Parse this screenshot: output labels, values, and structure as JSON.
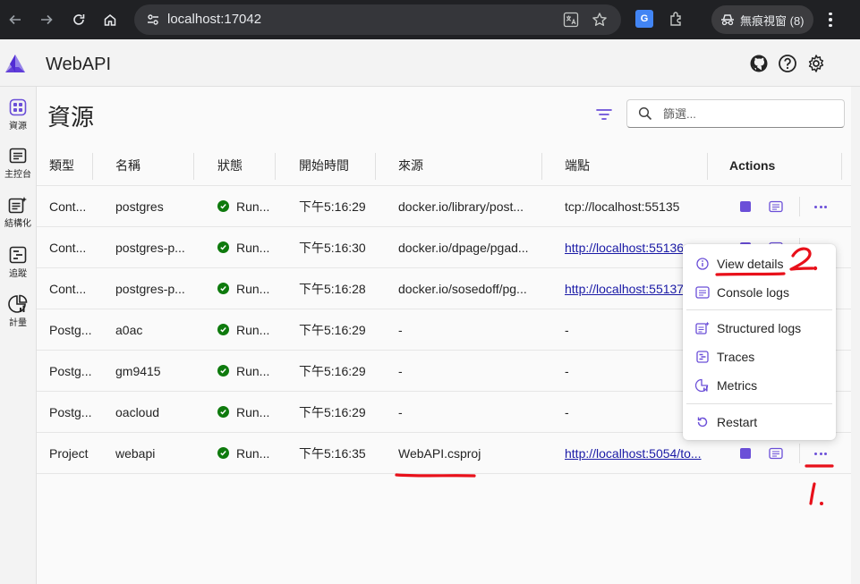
{
  "browser": {
    "url": "localhost:17042",
    "incognito_label": "無痕視窗 (8)",
    "icons": [
      "back-icon",
      "forward-icon",
      "reload-icon",
      "home-icon",
      "site-info-icon",
      "translate-icon",
      "star-icon",
      "extensions-icon",
      "incognito-icon",
      "kebab-menu-icon"
    ]
  },
  "app": {
    "title": "WebAPI",
    "header_icons": [
      "github-icon",
      "help-icon",
      "settings-icon"
    ]
  },
  "sidebar": {
    "items": [
      {
        "label": "資源",
        "icon": "resources-icon",
        "active": true
      },
      {
        "label": "主控台",
        "icon": "console-icon",
        "active": false
      },
      {
        "label": "結構化",
        "icon": "structured-icon",
        "active": false
      },
      {
        "label": "追蹤",
        "icon": "traces-icon",
        "active": false
      },
      {
        "label": "計量",
        "icon": "metrics-icon",
        "active": false
      }
    ]
  },
  "page": {
    "title": "資源",
    "search_placeholder": "篩選..."
  },
  "table": {
    "headers": {
      "type": "類型",
      "name": "名稱",
      "state": "狀態",
      "start": "開始時間",
      "source": "來源",
      "endpoint": "端點",
      "actions": "Actions"
    },
    "rows": [
      {
        "type": "Cont...",
        "name": "postgres",
        "state": "Run...",
        "start": "下午5:16:29",
        "source": "docker.io/library/post...",
        "endpoint": "tcp://localhost:55135",
        "endpoint_link": false
      },
      {
        "type": "Cont...",
        "name": "postgres-p...",
        "state": "Run...",
        "start": "下午5:16:30",
        "source": "docker.io/dpage/pgad...",
        "endpoint": "http://localhost:55136",
        "endpoint_link": true
      },
      {
        "type": "Cont...",
        "name": "postgres-p...",
        "state": "Run...",
        "start": "下午5:16:28",
        "source": "docker.io/sosedoff/pg...",
        "endpoint": "http://localhost:55137",
        "endpoint_link": true
      },
      {
        "type": "Postg...",
        "name": "a0ac",
        "state": "Run...",
        "start": "下午5:16:29",
        "source": "-",
        "endpoint": "-",
        "endpoint_link": false
      },
      {
        "type": "Postg...",
        "name": "gm9415",
        "state": "Run...",
        "start": "下午5:16:29",
        "source": "-",
        "endpoint": "-",
        "endpoint_link": false
      },
      {
        "type": "Postg...",
        "name": "oacloud",
        "state": "Run...",
        "start": "下午5:16:29",
        "source": "-",
        "endpoint": "-",
        "endpoint_link": false
      },
      {
        "type": "Project",
        "name": "webapi",
        "state": "Run...",
        "start": "下午5:16:35",
        "source": "WebAPI.csproj",
        "endpoint": "http://localhost:5054/to...",
        "endpoint_link": true
      }
    ]
  },
  "context_menu": {
    "items": [
      {
        "label": "View details",
        "icon": "info-icon"
      },
      {
        "label": "Console logs",
        "icon": "console-logs-icon"
      },
      {
        "label": "Structured logs",
        "icon": "structured-logs-icon"
      },
      {
        "label": "Traces",
        "icon": "traces-icon"
      },
      {
        "label": "Metrics",
        "icon": "metrics-icon"
      },
      {
        "label": "Restart",
        "icon": "restart-icon"
      }
    ]
  },
  "annotations": {
    "marker_1": "1.",
    "marker_2": "2."
  },
  "colors": {
    "accent": "#6b4fd8",
    "running": "#0e7a0d",
    "annotation": "#e8101a",
    "chrome": "#202124"
  }
}
